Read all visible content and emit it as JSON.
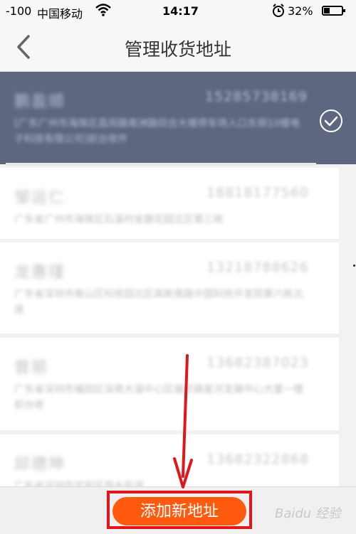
{
  "status_bar": {
    "signal": "-100",
    "carrier": "中国移动",
    "wifi_icon": "wifi-icon",
    "time": "14:17",
    "alarm_icon": "alarm-icon",
    "battery_percent": "32%",
    "battery_level": 0.32
  },
  "nav": {
    "back_icon": "chevron-left-icon",
    "title": "管理收货地址"
  },
  "addresses": [
    {
      "name": "鹏盈顺",
      "phone": "15285738169",
      "address": "[广东广州市海珠区昌岗路南洲路综合大楼停车场入口东侧10楼电子科技有限公司]前台收件",
      "selected": true
    },
    {
      "name": "邹运仁",
      "phone": "18818177560",
      "address": "广东省广州市海珠区石溪村金碧花园北区第三栋",
      "selected": false
    },
    {
      "name": "龙惠瑾",
      "phone": "13218788626",
      "address": "广东省深圳市南山区科技园北区高新南路中国科技开发院第六栋北座",
      "selected": false
    },
    {
      "name": "曾丽",
      "phone": "13682387023",
      "address": "广东省深圳市福田区深南大道中心区福华路星河发展中心大厦一楼前台收",
      "selected": false
    },
    {
      "name": "邱德坤",
      "phone": "13682322868",
      "address": "广东省深圳市宝安区西乡街道",
      "selected": false
    }
  ],
  "bottom": {
    "add_label": "添加新地址"
  },
  "watermark": "Baidu 经验",
  "colors": {
    "selected_bg": "#5d6780",
    "accent": "#ff5a0e",
    "annotation": "#e0161c"
  }
}
